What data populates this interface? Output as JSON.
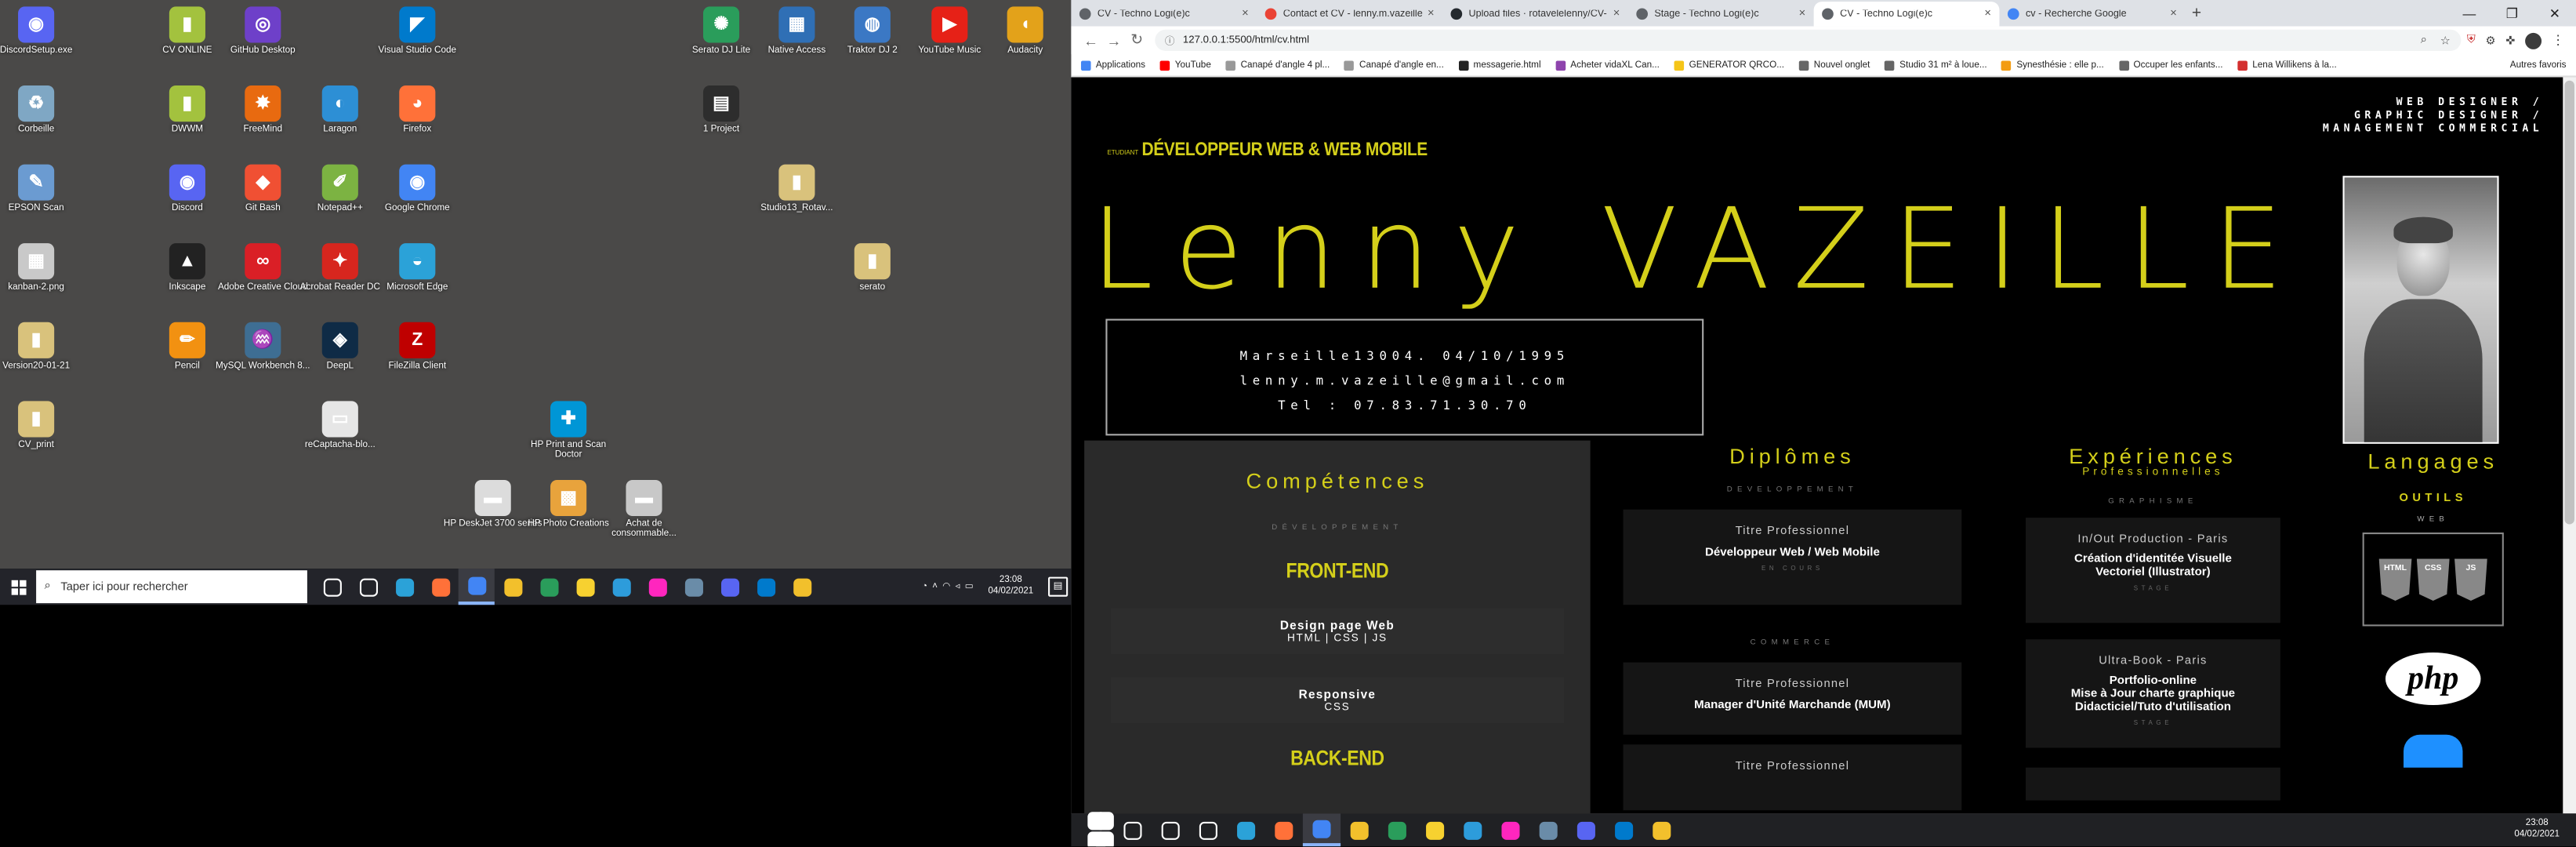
{
  "desktop": {
    "icons": [
      {
        "label": "DiscordSetup.exe",
        "icon": "discord-icon",
        "color": "#5865f2",
        "glyph": "◉",
        "col": 0,
        "row": 0
      },
      {
        "label": "CV ONLINE",
        "icon": "folder-icon",
        "color": "#a3c23e",
        "glyph": "▮",
        "col": 2,
        "row": 0
      },
      {
        "label": "GitHub Desktop",
        "icon": "github-icon",
        "color": "#6e40c9",
        "glyph": "◎",
        "col": 3,
        "row": 0
      },
      {
        "label": "Visual Studio Code",
        "icon": "vscode-icon",
        "color": "#007acc",
        "glyph": "◤",
        "col": 5,
        "row": 0
      },
      {
        "label": "Serato DJ Lite",
        "icon": "serato-icon",
        "color": "#2a9d5b",
        "glyph": "✺",
        "col": 9,
        "row": 0
      },
      {
        "label": "Native Access",
        "icon": "native-access-icon",
        "color": "#2f6fb5",
        "glyph": "▦",
        "col": 10,
        "row": 0
      },
      {
        "label": "Traktor DJ 2",
        "icon": "traktor-icon",
        "color": "#3b78c4",
        "glyph": "◍",
        "col": 11,
        "row": 0
      },
      {
        "label": "YouTube Music",
        "icon": "youtube-music-icon",
        "color": "#e62117",
        "glyph": "▶",
        "col": 12,
        "row": 0
      },
      {
        "label": "Audacity",
        "icon": "audacity-icon",
        "color": "#e3a21a",
        "glyph": "◖",
        "col": 13,
        "row": 0
      },
      {
        "label": "Corbeille",
        "icon": "recycle-bin-icon",
        "color": "#7fa7c4",
        "glyph": "♻",
        "col": 0,
        "row": 1
      },
      {
        "label": "DWWM",
        "icon": "folder-icon",
        "color": "#a3c23e",
        "glyph": "▮",
        "col": 2,
        "row": 1
      },
      {
        "label": "FreeMind",
        "icon": "freemind-icon",
        "color": "#e86a10",
        "glyph": "✸",
        "col": 3,
        "row": 1
      },
      {
        "label": "Laragon",
        "icon": "laragon-icon",
        "color": "#2d8fd5",
        "glyph": "◐",
        "col": 4,
        "row": 1
      },
      {
        "label": "Firefox",
        "icon": "firefox-icon",
        "color": "#ff7139",
        "glyph": "◕",
        "col": 5,
        "row": 1
      },
      {
        "label": "1 Project",
        "icon": "project-icon",
        "color": "#2d2d2d",
        "glyph": "▤",
        "col": 9,
        "row": 1
      },
      {
        "label": "EPSON Scan",
        "icon": "epson-scan-icon",
        "color": "#6b9bd1",
        "glyph": "✎",
        "col": 0,
        "row": 2
      },
      {
        "label": "Discord",
        "icon": "discord-icon",
        "color": "#5865f2",
        "glyph": "◉",
        "col": 2,
        "row": 2
      },
      {
        "label": "Git Bash",
        "icon": "git-bash-icon",
        "color": "#f05033",
        "glyph": "◆",
        "col": 3,
        "row": 2
      },
      {
        "label": "Notepad++",
        "icon": "notepad-icon",
        "color": "#7cb342",
        "glyph": "✐",
        "col": 4,
        "row": 2
      },
      {
        "label": "Google Chrome",
        "icon": "chrome-icon",
        "color": "#4285f4",
        "glyph": "◉",
        "col": 5,
        "row": 2
      },
      {
        "label": "Studio13_Rotav...",
        "icon": "folder-icon",
        "color": "#d9c27c",
        "glyph": "▮",
        "col": 10,
        "row": 2
      },
      {
        "label": "kanban-2.png",
        "icon": "image-file-icon",
        "color": "#c9c9c9",
        "glyph": "▦",
        "col": 0,
        "row": 3
      },
      {
        "label": "Inkscape",
        "icon": "inkscape-icon",
        "color": "#222222",
        "glyph": "▲",
        "col": 2,
        "row": 3
      },
      {
        "label": "Adobe Creative Cloud",
        "icon": "creative-cloud-icon",
        "color": "#da1f26",
        "glyph": "∞",
        "col": 3,
        "row": 3
      },
      {
        "label": "Acrobat Reader DC",
        "icon": "acrobat-icon",
        "color": "#d7261e",
        "glyph": "✦",
        "col": 4,
        "row": 3
      },
      {
        "label": "Microsoft Edge",
        "icon": "edge-icon",
        "color": "#2ba2d8",
        "glyph": "◒",
        "col": 5,
        "row": 3
      },
      {
        "label": "serato",
        "icon": "folder-icon",
        "color": "#d9c27c",
        "glyph": "▮",
        "col": 11,
        "row": 3
      },
      {
        "label": "Version20-01-21",
        "icon": "folder-icon",
        "color": "#d9c27c",
        "glyph": "▮",
        "col": 0,
        "row": 4
      },
      {
        "label": "Pencil",
        "icon": "pencil-icon",
        "color": "#f29111",
        "glyph": "✏",
        "col": 2,
        "row": 4
      },
      {
        "label": "MySQL Workbench 8...",
        "icon": "mysql-icon",
        "color": "#3e6e93",
        "glyph": "♒",
        "col": 3,
        "row": 4
      },
      {
        "label": "DeepL",
        "icon": "deepl-icon",
        "color": "#0f2b46",
        "glyph": "◈",
        "col": 4,
        "row": 4
      },
      {
        "label": "FileZilla Client",
        "icon": "filezilla-icon",
        "color": "#bf0000",
        "glyph": "Z",
        "col": 5,
        "row": 4
      },
      {
        "label": "CV_print",
        "icon": "folder-icon",
        "color": "#d9c27c",
        "glyph": "▮",
        "col": 0,
        "row": 5
      },
      {
        "label": "reCaptacha-blo...",
        "icon": "text-file-icon",
        "color": "#e6e6e6",
        "glyph": "▭",
        "col": 4,
        "row": 5
      },
      {
        "label": "HP Print and Scan Doctor",
        "icon": "hp-doctor-icon",
        "color": "#0096d6",
        "glyph": "✚",
        "col": 7,
        "row": 5
      },
      {
        "label": "HP DeskJet 3700 series",
        "icon": "printer-icon",
        "color": "#dcdcdc",
        "glyph": "▬",
        "col": 6,
        "row": 6
      },
      {
        "label": "HP Photo Creations",
        "icon": "hp-photo-icon",
        "color": "#e8a33c",
        "glyph": "▩",
        "col": 7,
        "row": 6
      },
      {
        "label": "Achat de consommable...",
        "icon": "printer-icon",
        "color": "#c8c8c8",
        "glyph": "▬",
        "col": 8,
        "row": 6
      }
    ]
  },
  "taskbar_left": {
    "search_placeholder": "Taper ici pour rechercher",
    "time": "23:08",
    "date": "04/02/2021",
    "apps": [
      {
        "icon": "task-view-icon",
        "color": "#ffffff"
      },
      {
        "icon": "widgets-icon",
        "color": "#ffffff"
      },
      {
        "icon": "edge-icon",
        "color": "#2ba2d8"
      },
      {
        "icon": "firefox-icon",
        "color": "#ff7139"
      },
      {
        "icon": "chrome-icon",
        "color": "#4285f4",
        "active": true
      },
      {
        "icon": "file-explorer-icon",
        "color": "#f2c02c"
      },
      {
        "icon": "serato-icon",
        "color": "#2a9d5b"
      },
      {
        "icon": "sticky-notes-icon",
        "color": "#f7d130"
      },
      {
        "icon": "ps-icon",
        "color": "#2d9cdb"
      },
      {
        "icon": "xd-icon",
        "color": "#ff26be"
      },
      {
        "icon": "gimp-icon",
        "color": "#6a8ca8"
      },
      {
        "icon": "discord-icon",
        "color": "#5865f2"
      },
      {
        "icon": "vscode-icon",
        "color": "#007acc"
      },
      {
        "icon": "notes-icon",
        "color": "#f2c02c"
      }
    ]
  },
  "browser": {
    "tabs": [
      {
        "title": "CV - Techno Logi(e)c",
        "color": "#5f6368"
      },
      {
        "title": "Contact et CV - lenny.m.vazeille@",
        "color": "#ea4335"
      },
      {
        "title": "Upload files · rotavelelenny/CV-",
        "color": "#24292e"
      },
      {
        "title": "Stage - Techno Logi(e)c",
        "color": "#5f6368"
      },
      {
        "title": "CV - Techno Logi(e)c",
        "color": "#5f6368",
        "active": true
      },
      {
        "title": "cv - Recherche Google",
        "color": "#4285f4"
      }
    ],
    "url": "127.0.0.1:5500/html/cv.html",
    "bookmarks": [
      {
        "label": "Applications",
        "color": "#4285f4"
      },
      {
        "label": "YouTube",
        "color": "#ff0000"
      },
      {
        "label": "Canapé d'angle 4 pl...",
        "color": "#999999"
      },
      {
        "label": "Canapé d'angle en...",
        "color": "#999999"
      },
      {
        "label": "messagerie.html",
        "color": "#222222"
      },
      {
        "label": "Acheter vidaXL Can...",
        "color": "#8e44ad"
      },
      {
        "label": "GENERATOR QRCO...",
        "color": "#f5c518"
      },
      {
        "label": "Nouvel onglet",
        "color": "#666666"
      },
      {
        "label": "Studio 31 m² à loue...",
        "color": "#666666"
      },
      {
        "label": "Synesthésie : elle p...",
        "color": "#f39c12"
      },
      {
        "label": "Occuper les enfants...",
        "color": "#666666"
      },
      {
        "label": "Lena Willikens à la...",
        "color": "#d32f2f"
      }
    ],
    "other_bookmarks": "Autres favoris",
    "window_controls": {
      "min": "—",
      "max": "❐",
      "close": "✕"
    }
  },
  "cv": {
    "role_prefix": "ETUDIANT",
    "role": "DÉVELOPPEUR WEB & WEB MOBILE",
    "top_right": [
      "WEB DESIGNER /",
      "GRAPHIC DESIGNER /",
      "MANAGEMENT COMMERCIAL"
    ],
    "name": "Lenny VAZEILLE",
    "contact": [
      "Marseille13004. 04/10/1995",
      "lenny.m.vazeille@gmail.com",
      "Tel : 07.83.71.30.70"
    ],
    "competences": {
      "title": "Compétences",
      "subtitle": "DÉVELOPPEMENT",
      "frontend": "FRONT-END",
      "items": [
        {
          "title": "Design page Web",
          "tech": "HTML | CSS | JS"
        },
        {
          "title": "Responsive",
          "tech": "CSS"
        }
      ],
      "backend": "BACK-END"
    },
    "diplomes": {
      "title": "Diplômes",
      "sub1": "DEVELOPPEMENT",
      "card1": {
        "t": "Titre Professionnel",
        "b": "Développeur Web / Web Mobile",
        "s": "EN COURS"
      },
      "sub2": "COMMERCE",
      "card2": {
        "t": "Titre Professionnel",
        "b": "Manager d'Unité Marchande (MUM)"
      },
      "card3": {
        "t": "Titre Professionnel"
      }
    },
    "experiences": {
      "title": "Expériences",
      "subtitle": "Professionnelles",
      "sub1": "GRAPHISME",
      "card1": {
        "t": "In/Out Production - Paris",
        "b1": "Création d'identitée Visuelle",
        "b2": "Vectoriel (Illustrator)",
        "s": "STAGE"
      },
      "card2": {
        "t": "Ultra-Book - Paris",
        "b1": "Portfolio-online",
        "b2": "Mise à Jour charte graphique",
        "b3": "Didacticiel/Tuto d'utilisation",
        "s": "STAGE"
      }
    },
    "langages": {
      "title": "Langages",
      "outils": "OUTILS",
      "web": "WEB",
      "html": "HTML",
      "css": "CSS",
      "js": "JS",
      "php": "php"
    }
  },
  "taskbar_right": {
    "time": "23:08",
    "date": "04/02/2021",
    "apps": [
      {
        "icon": "search-icon",
        "color": "#ffffff"
      },
      {
        "icon": "cortana-icon",
        "color": "#ffffff"
      },
      {
        "icon": "task-view-icon",
        "color": "#ffffff"
      },
      {
        "icon": "edge-icon",
        "color": "#2ba2d8"
      },
      {
        "icon": "firefox-icon",
        "color": "#ff7139"
      },
      {
        "icon": "chrome-icon",
        "color": "#4285f4",
        "active": true
      },
      {
        "icon": "file-explorer-icon",
        "color": "#f2c02c"
      },
      {
        "icon": "serato-icon",
        "color": "#2a9d5b"
      },
      {
        "icon": "sticky-notes-icon",
        "color": "#f7d130"
      },
      {
        "icon": "ps-icon",
        "color": "#2d9cdb"
      },
      {
        "icon": "xd-icon",
        "color": "#ff26be"
      },
      {
        "icon": "gimp-icon",
        "color": "#6a8ca8"
      },
      {
        "icon": "discord-icon",
        "color": "#5865f2"
      },
      {
        "icon": "vscode-icon",
        "color": "#007acc"
      },
      {
        "icon": "notes-icon",
        "color": "#f2c02c"
      }
    ]
  }
}
